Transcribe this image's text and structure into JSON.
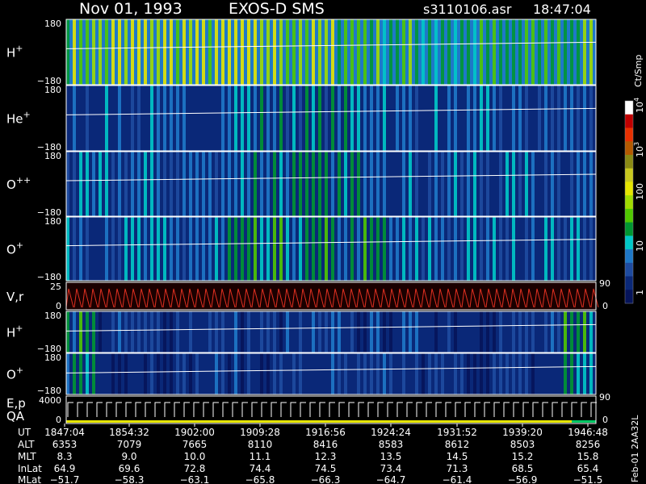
{
  "header": {
    "date": "Nov 01, 1993",
    "instrument": "EXOS-D SMS",
    "file": "s3110106.asr",
    "time": "18:47:04"
  },
  "colorbar": {
    "unit": "Ct/Smp",
    "tick_labels": [
      "1",
      "10",
      "100",
      "10",
      "10"
    ],
    "tick_exponents": [
      "",
      "",
      "",
      "3",
      "4"
    ],
    "colors": [
      "#ffffff",
      "#c00000",
      "#e83000",
      "#b45a00",
      "#8a8a14",
      "#c8c81e",
      "#e6e600",
      "#a0dc00",
      "#50c800",
      "#009632",
      "#00c8c8",
      "#1e78c8",
      "#1e4ba0",
      "#0a2878",
      "#06145a"
    ]
  },
  "panels": [
    {
      "label": "H",
      "sup": "+",
      "ymax": "180",
      "ymin": "−180",
      "level": 0.75
    },
    {
      "label": "He",
      "sup": "+",
      "ymax": "180",
      "ymin": "−180",
      "level": 0.3
    },
    {
      "label": "O",
      "sup": "++",
      "ymax": "180",
      "ymin": "−180",
      "level": 0.35
    },
    {
      "label": "O",
      "sup": "+",
      "ymax": "180",
      "ymin": "−180",
      "level": 0.38
    },
    {
      "label": "V,r",
      "sup": "",
      "ymax": "25",
      "ymin": "0",
      "yright_top": "90",
      "yright_bot": "0"
    },
    {
      "label": "H",
      "sup": "+",
      "ymax": "180",
      "ymin": "−180",
      "level": 0.22
    },
    {
      "label": "O",
      "sup": "+",
      "ymax": "180",
      "ymin": "−180",
      "level": 0.2
    },
    {
      "label": "E,p",
      "label2": "QA",
      "sup": "",
      "ymax": "4000",
      "ymin": "0",
      "yright_top": "90",
      "yright_bot": "0"
    }
  ],
  "footer": {
    "row_labels": [
      "UT",
      "ALT",
      "MLT",
      "InLat",
      "MLat"
    ],
    "columns": [
      [
        "1847:04",
        "6353",
        "8.3",
        "64.9",
        "−51.7"
      ],
      [
        "1854:32",
        "7079",
        "9.0",
        "69.6",
        "−58.3"
      ],
      [
        "1902:00",
        "7665",
        "10.0",
        "72.8",
        "−63.1"
      ],
      [
        "1909:28",
        "8110",
        "11.1",
        "74.4",
        "−65.8"
      ],
      [
        "1916:56",
        "8416",
        "12.3",
        "74.5",
        "−66.3"
      ],
      [
        "1924:24",
        "8583",
        "13.5",
        "73.4",
        "−64.7"
      ],
      [
        "1931:52",
        "8612",
        "14.5",
        "71.3",
        "−61.4"
      ],
      [
        "1939:20",
        "8503",
        "15.2",
        "68.5",
        "−56.9"
      ],
      [
        "1946:48",
        "8256",
        "15.8",
        "65.4",
        "−51.5"
      ]
    ],
    "side_label": "Feb-01 2AA32L"
  },
  "chart_data": {
    "type": "heatmap",
    "title": "Nov 01, 1993   EXOS-D SMS",
    "x": [
      "1847:04",
      "1854:32",
      "1902:00",
      "1909:28",
      "1916:56",
      "1924:24",
      "1931:52",
      "1939:20",
      "1946:48"
    ],
    "series": [
      {
        "name": "H+",
        "yrange": [
          -180,
          180
        ]
      },
      {
        "name": "He+",
        "yrange": [
          -180,
          180
        ]
      },
      {
        "name": "O++",
        "yrange": [
          -180,
          180
        ]
      },
      {
        "name": "O+",
        "yrange": [
          -180,
          180
        ]
      },
      {
        "name": "V,r",
        "yrange": [
          0,
          25
        ]
      },
      {
        "name": "H+",
        "yrange": [
          -180,
          180
        ]
      },
      {
        "name": "O+",
        "yrange": [
          -180,
          180
        ]
      },
      {
        "name": "E,p",
        "yrange": [
          0,
          4000
        ]
      }
    ],
    "colorbar_unit": "Ct/Smp"
  }
}
